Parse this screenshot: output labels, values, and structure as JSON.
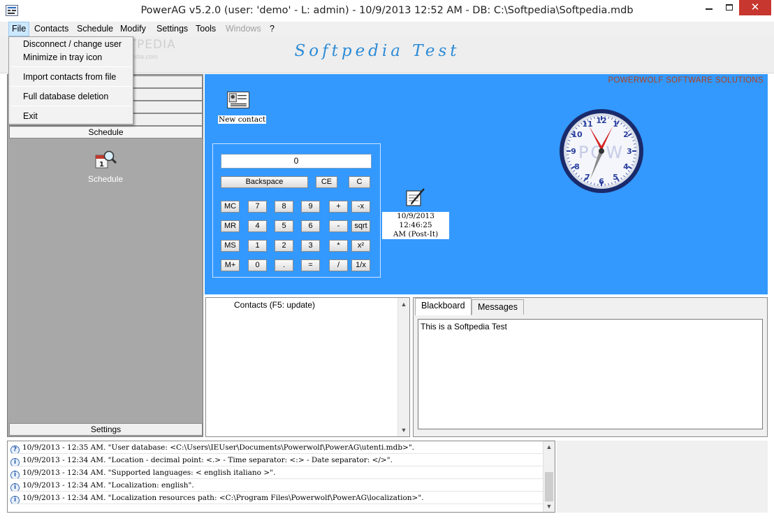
{
  "window": {
    "title": "PowerAG v5.2.0  (user: 'demo'  - L: admin) - 10/9/2013 12:52 AM - DB: C:\\Softpedia\\Softpedia.mdb",
    "close_glyph": "✕"
  },
  "menu": {
    "items": [
      "File",
      "Contacts",
      "Schedule",
      "Modify",
      "Settings",
      "Tools",
      "Windows",
      "?"
    ],
    "active": "File",
    "disabled": [
      "Windows"
    ]
  },
  "file_menu": {
    "items": [
      "Disconnect / change user",
      "Minimize in tray icon",
      "Import contacts from file",
      "Full database deletion",
      "Exit"
    ]
  },
  "banner": {
    "title": "Softpedia Test",
    "watermark": "SOFTPEDIA",
    "watermark_url": "www.softpedia.com"
  },
  "left_panel": {
    "selected_tab": "Schedule",
    "icon": "calendar-magnifier-icon",
    "icon_label": "Schedule",
    "bottom_tab": "Settings"
  },
  "main_panel": {
    "company": "POWERWOLF SOFTWARE SOLUTIONS",
    "new_contact_label": "New contact",
    "postit_line1": "10/9/2013 12:46:25",
    "postit_line2": "AM (Post-It)",
    "clock_text": "POW",
    "clock_time": "12:52",
    "bg_color": "#3399ff"
  },
  "calculator": {
    "display": "0",
    "top_buttons": [
      "Backspace",
      "CE",
      "C"
    ],
    "rows": [
      [
        "MC",
        "7",
        "8",
        "9",
        "+",
        "-x"
      ],
      [
        "MR",
        "4",
        "5",
        "6",
        "-",
        "sqrt"
      ],
      [
        "MS",
        "1",
        "2",
        "3",
        "*",
        "x²"
      ],
      [
        "M+",
        "0",
        ".",
        "=",
        "/",
        "1/x"
      ]
    ]
  },
  "contacts": {
    "label": "Contacts  (F5: update)"
  },
  "notes": {
    "tabs": [
      "Blackboard",
      "Messages"
    ],
    "selected": "Blackboard",
    "content": "This is a Softpedia Test"
  },
  "log": {
    "entries": [
      {
        "icon": "?",
        "text": "10/9/2013 - 12:35 AM. \"User database: <C:\\Users\\IEUser\\Documents\\Powerwolf\\PowerAG\\utenti.mdb>\"."
      },
      {
        "icon": "i",
        "text": "10/9/2013 - 12:34 AM. \"Location - decimal point: <.> - Time separator: <:> - Date separator: </>\"."
      },
      {
        "icon": "i",
        "text": "10/9/2013 - 12:34 AM. \"Supported languages: < english italiano >\"."
      },
      {
        "icon": "i",
        "text": "10/9/2013 - 12:34 AM. \"Localization: english\"."
      },
      {
        "icon": "i",
        "text": "10/9/2013 - 12:34 AM. \"Localization resources path: <C:\\Program Files\\Powerwolf\\PowerAG\\localization>\"."
      }
    ]
  }
}
